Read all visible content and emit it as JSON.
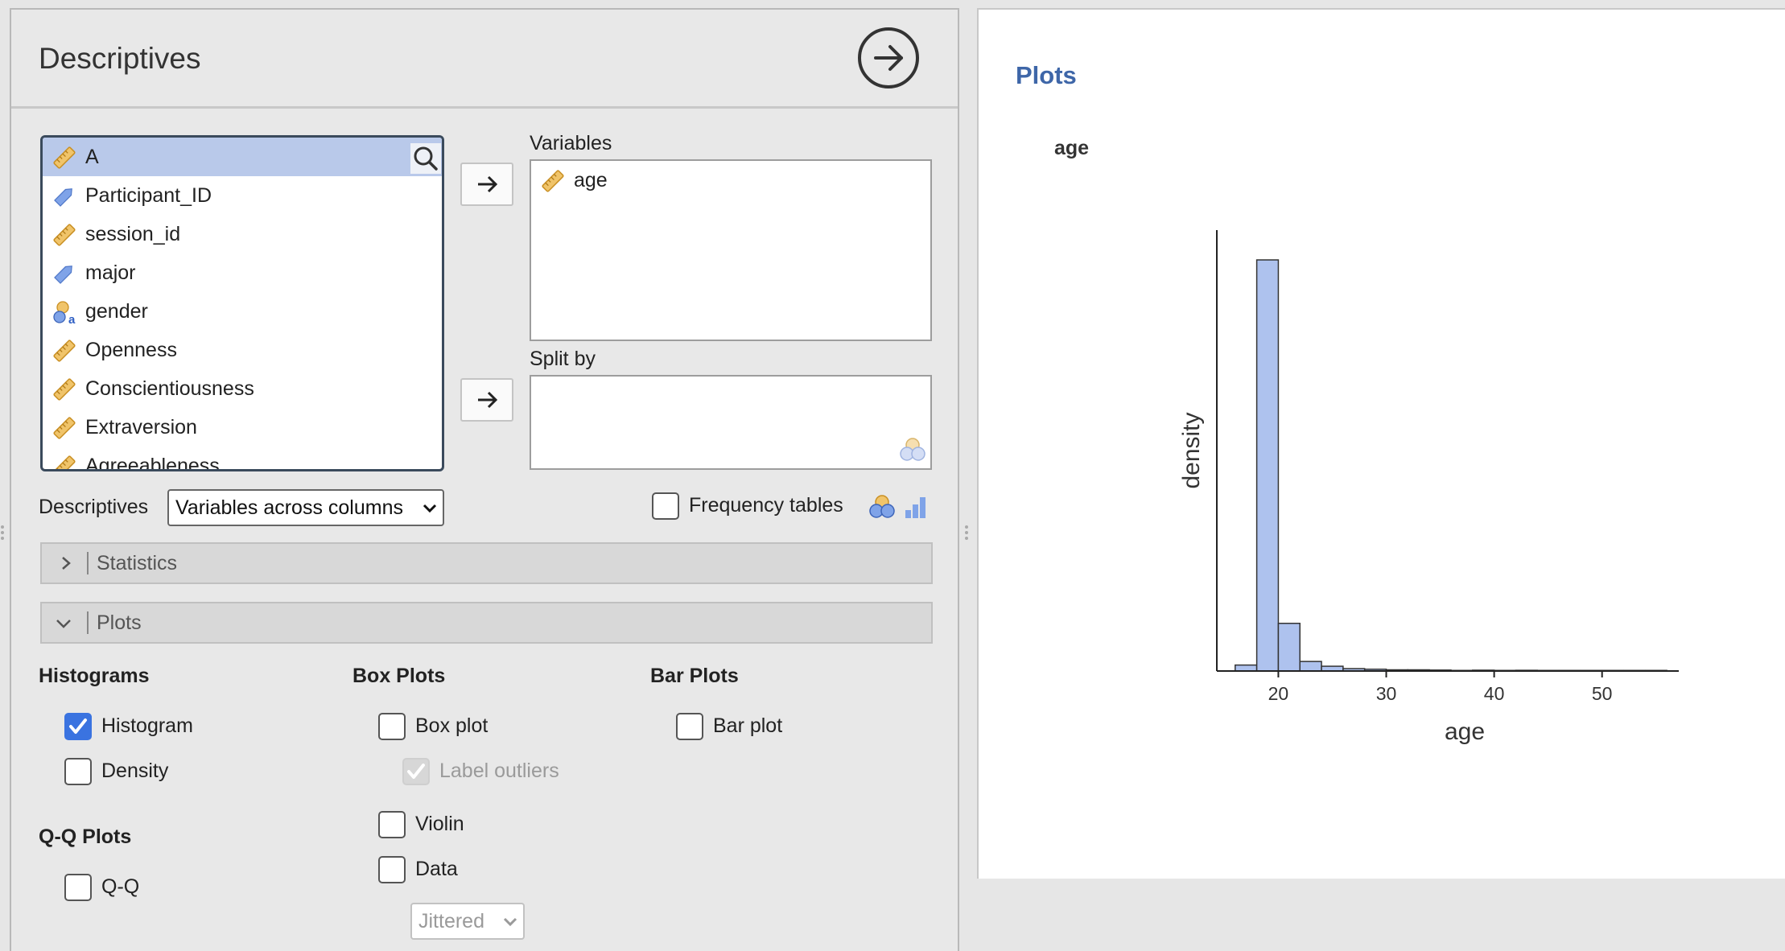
{
  "options_panel": {
    "title": "Descriptives",
    "variable_list": [
      {
        "label": "A",
        "icon": "ruler-icon",
        "selected": true
      },
      {
        "label": "Participant_ID",
        "icon": "nominal-text-icon"
      },
      {
        "label": "session_id",
        "icon": "ruler-icon"
      },
      {
        "label": "major",
        "icon": "nominal-text-icon"
      },
      {
        "label": "gender",
        "icon": "nominal-icon"
      },
      {
        "label": "Openness",
        "icon": "ruler-icon"
      },
      {
        "label": "Conscientiousness",
        "icon": "ruler-icon"
      },
      {
        "label": "Extraversion",
        "icon": "ruler-icon"
      },
      {
        "label": "Agreeableness",
        "icon": "ruler-icon"
      }
    ],
    "variables_label": "Variables",
    "variables_assigned": [
      {
        "label": "age",
        "icon": "ruler-icon"
      }
    ],
    "split_by_label": "Split by",
    "descriptives_label": "Descriptives",
    "descriptives_select": "Variables across columns",
    "frequency_tables_label": "Frequency tables",
    "frequency_tables_checked": false,
    "sections": {
      "statistics": {
        "label": "Statistics",
        "expanded": false
      },
      "plots": {
        "label": "Plots",
        "expanded": true
      }
    },
    "histograms": {
      "title": "Histograms",
      "histogram": {
        "label": "Histogram",
        "checked": true
      },
      "density": {
        "label": "Density",
        "checked": false
      }
    },
    "qq_plots": {
      "title": "Q-Q Plots",
      "qq": {
        "label": "Q-Q",
        "checked": false
      }
    },
    "box_plots": {
      "title": "Box Plots",
      "box_plot": {
        "label": "Box plot",
        "checked": false
      },
      "label_outliers": {
        "label": "Label outliers",
        "checked": true,
        "disabled": true
      },
      "violin": {
        "label": "Violin",
        "checked": false
      },
      "data": {
        "label": "Data",
        "checked": false
      },
      "data_mode": "Jittered"
    },
    "bar_plots": {
      "title": "Bar Plots",
      "bar_plot": {
        "label": "Bar plot",
        "checked": false
      }
    }
  },
  "results": {
    "heading": "Plots",
    "plot_title": "age"
  },
  "chart_data": {
    "type": "bar",
    "xlabel": "age",
    "ylabel": "density",
    "x_ticks": [
      20,
      30,
      40,
      50
    ],
    "xlim": [
      14.3,
      58.6
    ],
    "ylim": [
      0,
      0.37
    ],
    "bin_width": 2,
    "bins": [
      {
        "x0": 16,
        "x1": 18,
        "y": 0.005
      },
      {
        "x0": 18,
        "x1": 20,
        "y": 0.345
      },
      {
        "x0": 20,
        "x1": 22,
        "y": 0.04
      },
      {
        "x0": 22,
        "x1": 24,
        "y": 0.008
      },
      {
        "x0": 24,
        "x1": 26,
        "y": 0.004
      },
      {
        "x0": 26,
        "x1": 28,
        "y": 0.002
      },
      {
        "x0": 28,
        "x1": 30,
        "y": 0.0015
      },
      {
        "x0": 30,
        "x1": 32,
        "y": 0.001
      },
      {
        "x0": 32,
        "x1": 34,
        "y": 0.001
      },
      {
        "x0": 34,
        "x1": 36,
        "y": 0.0008
      },
      {
        "x0": 36,
        "x1": 38,
        "y": 0.0005
      },
      {
        "x0": 38,
        "x1": 40,
        "y": 0.0007
      },
      {
        "x0": 40,
        "x1": 42,
        "y": 0.0005
      },
      {
        "x0": 42,
        "x1": 44,
        "y": 0.0006
      },
      {
        "x0": 44,
        "x1": 46,
        "y": 0.0005
      },
      {
        "x0": 46,
        "x1": 48,
        "y": 0.0005
      },
      {
        "x0": 48,
        "x1": 50,
        "y": 0.0005
      },
      {
        "x0": 50,
        "x1": 52,
        "y": 0.0005
      },
      {
        "x0": 52,
        "x1": 54,
        "y": 0.0005
      },
      {
        "x0": 54,
        "x1": 56,
        "y": 0.0005
      }
    ],
    "bar_color": "#aec2ee",
    "bar_stroke": "#333333"
  },
  "colors": {
    "accent_blue": "#3a73e0",
    "results_heading": "#3e66a8",
    "selected_row": "#b9c9ea",
    "ruler_icon": "#e9b551"
  }
}
